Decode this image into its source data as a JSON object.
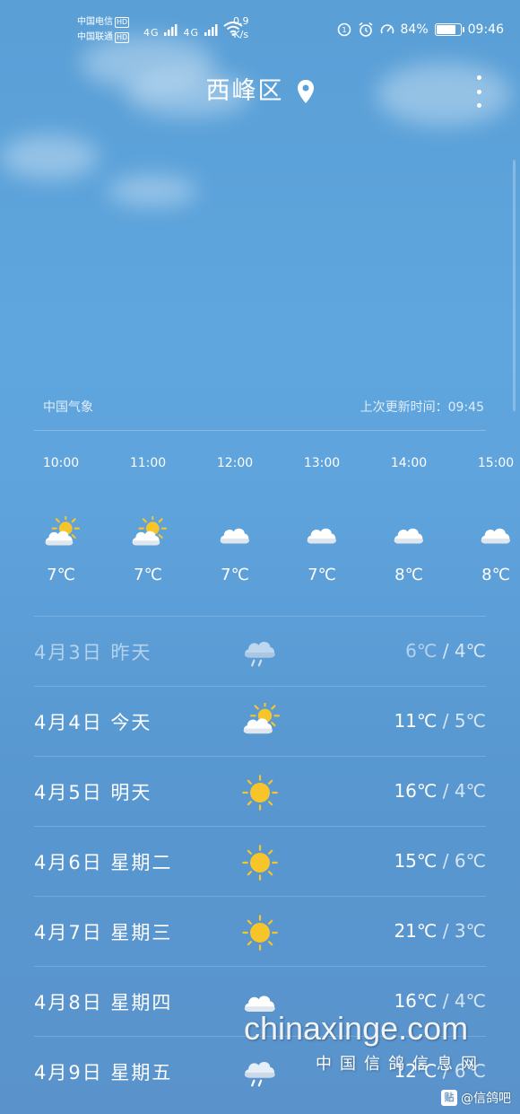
{
  "status_bar": {
    "carrier_1": "中国电信",
    "carrier_2": "中国联通",
    "hd_badge": "HD",
    "signal_1": "4G",
    "signal_2": "4G",
    "net_speed_value": "0.9",
    "net_speed_unit": "K/s",
    "battery_text": "84%",
    "battery_level": 0.84,
    "time": "09:46"
  },
  "header": {
    "city": "西峰区"
  },
  "source": {
    "provider": "中国气象",
    "update_label": "上次更新时间：09:45"
  },
  "hourly": [
    {
      "time": "10:00",
      "icon": "partly-cloudy-icon",
      "temp": "7℃"
    },
    {
      "time": "11:00",
      "icon": "partly-cloudy-icon",
      "temp": "7℃"
    },
    {
      "time": "12:00",
      "icon": "cloudy-icon",
      "temp": "7℃"
    },
    {
      "time": "13:00",
      "icon": "cloudy-icon",
      "temp": "7℃"
    },
    {
      "time": "14:00",
      "icon": "cloudy-icon",
      "temp": "8℃"
    },
    {
      "time": "15:00",
      "icon": "cloudy-icon",
      "temp": "8℃"
    }
  ],
  "daily": [
    {
      "date": "4月3日 昨天",
      "icon": "rain-icon",
      "high": "6℃",
      "low": "4℃",
      "past": true
    },
    {
      "date": "4月4日 今天",
      "icon": "partly-cloudy-icon",
      "high": "11℃",
      "low": "5℃",
      "past": false
    },
    {
      "date": "4月5日 明天",
      "icon": "sunny-icon",
      "high": "16℃",
      "low": "4℃",
      "past": false
    },
    {
      "date": "4月6日 星期二",
      "icon": "sunny-icon",
      "high": "15℃",
      "low": "6℃",
      "past": false
    },
    {
      "date": "4月7日 星期三",
      "icon": "sunny-icon",
      "high": "21℃",
      "low": "3℃",
      "past": false
    },
    {
      "date": "4月8日 星期四",
      "icon": "cloudy-icon",
      "high": "16℃",
      "low": "4℃",
      "past": false
    },
    {
      "date": "4月9日 星期五",
      "icon": "rain-icon",
      "high": "12℃",
      "low": "6℃",
      "past": false
    }
  ],
  "watermark": {
    "site": "chinaxinge.com",
    "site_cn": "中国信鸽信息网",
    "tieba_logo": "贴",
    "tieba": "@信鸽吧"
  },
  "colors": {
    "sky_top": "#5a9fd6",
    "sky_bottom": "#5a93cc",
    "sun": "#f7c52a"
  }
}
